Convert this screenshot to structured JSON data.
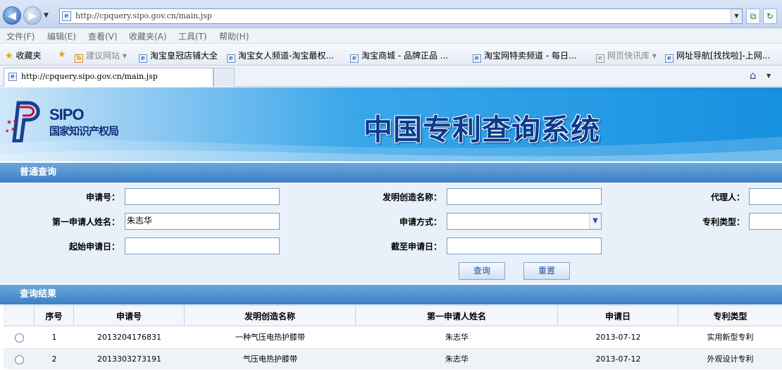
{
  "browser": {
    "url": "http://cpquery.sipo.gov.cn/main.jsp",
    "menu": [
      "文件(F)",
      "编辑(E)",
      "查看(V)",
      "收藏夹(A)",
      "工具(T)",
      "帮助(H)"
    ],
    "favorites_label": "收藏夹",
    "favorites": [
      {
        "label": "建议网站 ▾",
        "grey": true
      },
      {
        "label": "淘宝皇冠店铺大全"
      },
      {
        "label": "淘宝女人频道-淘宝最权..."
      },
      {
        "label": "淘宝商城 - 品牌正品 ..."
      },
      {
        "label": "淘宝网特卖频道 - 每日..."
      },
      {
        "label": "网页快讯库 ▾",
        "grey": true
      },
      {
        "label": "网址导航[找找啦]-上网..."
      }
    ],
    "tab_title": "http://cpquery.sipo.gov.cn/main.jsp"
  },
  "banner": {
    "logo_text": "SIPO",
    "logo_cn": "国家知识产权局",
    "title": "中国专利查询系统"
  },
  "query": {
    "section_title": "普通查询",
    "labels": {
      "app_no": "申请号：",
      "invention_name": "发明创造名称：",
      "agent": "代理人：",
      "first_applicant": "第一申请人姓名：",
      "app_method": "申请方式：",
      "patent_type": "专利类型：",
      "start_date": "起始申请日：",
      "end_date": "截至申请日："
    },
    "values": {
      "first_applicant": "朱志华"
    },
    "buttons": {
      "search": "查询",
      "reset": "重置"
    }
  },
  "results": {
    "section_title": "查询结果",
    "columns": [
      "序号",
      "申请号",
      "发明创造名称",
      "第一申请人姓名",
      "申请日",
      "专利类型"
    ],
    "rows": [
      [
        "1",
        "2013204176831",
        "一种气压电热护膝带",
        "朱志华",
        "2013-07-12",
        "实用新型专利"
      ],
      [
        "2",
        "2013303273191",
        "气压电热护膝带",
        "朱志华",
        "2013-07-12",
        "外观设计专利"
      ]
    ]
  },
  "colors": {
    "section_bar": "#3d7fc4",
    "query_bg": "#e8f1fa",
    "banner_title": "#0a3b8c"
  }
}
